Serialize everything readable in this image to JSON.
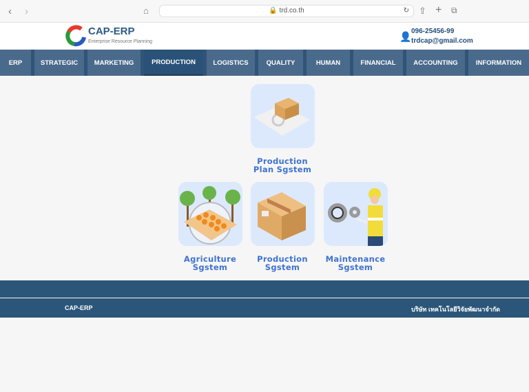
{
  "browser": {
    "url": "trd.co.th"
  },
  "header": {
    "brand": "CAP-ERP",
    "tagline": "Enterprise Resource Planning",
    "phone": "096-25456-99",
    "email": "trdcap@gmail.com"
  },
  "nav": {
    "items": [
      "ERP",
      "STRATEGIC",
      "MARKETING",
      "PRODUCTION",
      "LOGISTICS",
      "QUALITY",
      "HUMAN",
      "FINANCIAL",
      "ACCOUNTING",
      "INFORMATION"
    ],
    "active": "PRODUCTION"
  },
  "modules": [
    {
      "line1": "Production",
      "line2": "Plan Sgstem"
    },
    {
      "line1": "Agriculture",
      "line2": "Sgstem"
    },
    {
      "line1": "Production",
      "line2": "Sgstem"
    },
    {
      "line1": "Maintenance",
      "line2": "Sgstem"
    }
  ],
  "footer": {
    "left": "CAP-ERP",
    "right": "บริษัท เทคโนโลยีวิจัยพัฒนาจำกัด"
  }
}
